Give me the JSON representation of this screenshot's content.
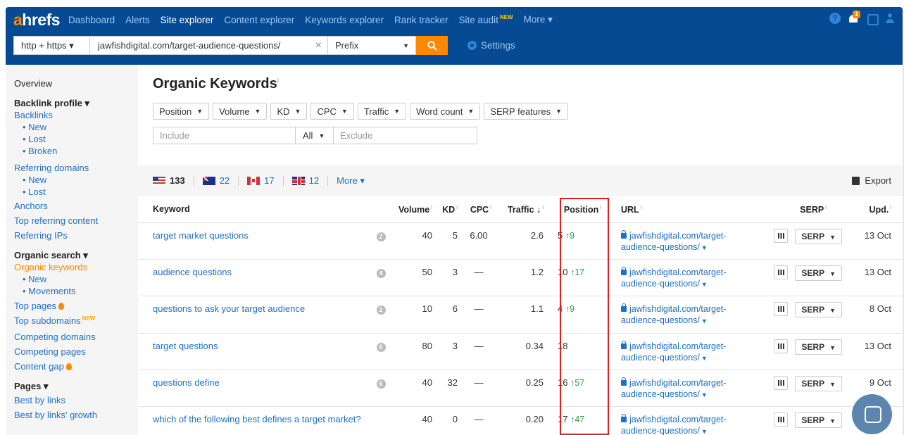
{
  "nav": {
    "logo_a": "a",
    "logo_rest": "hrefs",
    "items": [
      "Dashboard",
      "Alerts",
      "Site explorer",
      "Content explorer",
      "Keywords explorer",
      "Rank tracker",
      "Site audit",
      "More ▾"
    ],
    "site_audit_badge": "NEW",
    "notif_count": "1"
  },
  "search": {
    "protocol": "http + https ▾",
    "url": "jawfishdigital.com/target-audience-questions/",
    "mode": "Prefix",
    "mode_caret": "▼",
    "clear": "×",
    "settings": "Settings"
  },
  "sidebar": {
    "overview": "Overview",
    "backlink_profile": "Backlink profile ▾",
    "backlinks": "Backlinks",
    "bl_new": "New",
    "bl_lost": "Lost",
    "bl_broken": "Broken",
    "referring_domains": "Referring domains",
    "rd_new": "New",
    "rd_lost": "Lost",
    "anchors": "Anchors",
    "top_referring_content": "Top referring content",
    "referring_ips": "Referring IPs",
    "organic_search": "Organic search ▾",
    "organic_keywords": "Organic keywords",
    "ok_new": "New",
    "ok_movements": "Movements",
    "top_pages": "Top pages",
    "top_subdomains": "Top subdomains",
    "top_subdomains_badge": "NEW",
    "competing_domains": "Competing domains",
    "competing_pages": "Competing pages",
    "content_gap": "Content gap",
    "pages": "Pages ▾",
    "best_by_links": "Best by links",
    "best_by_links_growth": "Best by links' growth"
  },
  "main": {
    "title": "Organic Keywords",
    "title_info": "i",
    "filters": [
      "Position",
      "Volume",
      "KD",
      "CPC",
      "Traffic",
      "Word count",
      "SERP features"
    ],
    "include_placeholder": "Include",
    "all_label": "All",
    "exclude_placeholder": "Exclude",
    "countries": [
      {
        "flag": "us",
        "count": "133"
      },
      {
        "flag": "au",
        "count": "22"
      },
      {
        "flag": "ca",
        "count": "17"
      },
      {
        "flag": "gb",
        "count": "12"
      }
    ],
    "more_label": "More ▾",
    "export_label": "Export"
  },
  "table": {
    "headers": {
      "keyword": "Keyword",
      "volume": "Volume",
      "kd": "KD",
      "cpc": "CPC",
      "traffic": "Traffic ↓",
      "position": "Position",
      "url": "URL",
      "serp": "SERP",
      "upd": "Upd."
    },
    "rows": [
      {
        "keyword": "target market questions",
        "badge": "2",
        "volume": "40",
        "kd": "5",
        "cpc": "6.00",
        "traffic": "2.6",
        "pos": "5",
        "change": "↑9",
        "url1": "jawfishdigital.com/target-",
        "url2": "audience-questions/",
        "serp": "SERP",
        "upd": "13 Oct"
      },
      {
        "keyword": "audience questions",
        "badge": "4",
        "volume": "50",
        "kd": "3",
        "cpc": "—",
        "traffic": "1.2",
        "pos": "10",
        "change": "↑17",
        "url1": "jawfishdigital.com/target-",
        "url2": "audience-questions/",
        "serp": "SERP",
        "upd": "13 Oct"
      },
      {
        "keyword": "questions to ask your target audience",
        "badge": "2",
        "volume": "10",
        "kd": "6",
        "cpc": "—",
        "traffic": "1.1",
        "pos": "4",
        "change": "↑9",
        "url1": "jawfishdigital.com/target-",
        "url2": "audience-questions/",
        "serp": "SERP",
        "upd": "8 Oct"
      },
      {
        "keyword": "target questions",
        "badge": "6",
        "volume": "80",
        "kd": "3",
        "cpc": "—",
        "traffic": "0.34",
        "pos": "18",
        "change": "",
        "url1": "jawfishdigital.com/target-",
        "url2": "audience-questions/",
        "serp": "SERP",
        "upd": "13 Oct"
      },
      {
        "keyword": "questions define",
        "badge": "6",
        "volume": "40",
        "kd": "32",
        "cpc": "—",
        "traffic": "0.25",
        "pos": "16",
        "change": "↑57",
        "url1": "jawfishdigital.com/target-",
        "url2": "audience-questions/",
        "serp": "SERP",
        "upd": "9 Oct"
      },
      {
        "keyword": "which of the following best defines a target market?",
        "badge": "",
        "volume": "40",
        "kd": "0",
        "cpc": "—",
        "traffic": "0.20",
        "pos": "17",
        "change": "↑47",
        "url1": "jawfishdigital.com/target-",
        "url2": "audience-questions/",
        "serp": "SERP",
        "upd": ""
      }
    ]
  },
  "colors": {
    "nav_bg": "#054a93",
    "accent": "#ff8800",
    "link": "#1e6fc7",
    "highlight_box": "#e01e1e",
    "positive": "#27a24a"
  }
}
